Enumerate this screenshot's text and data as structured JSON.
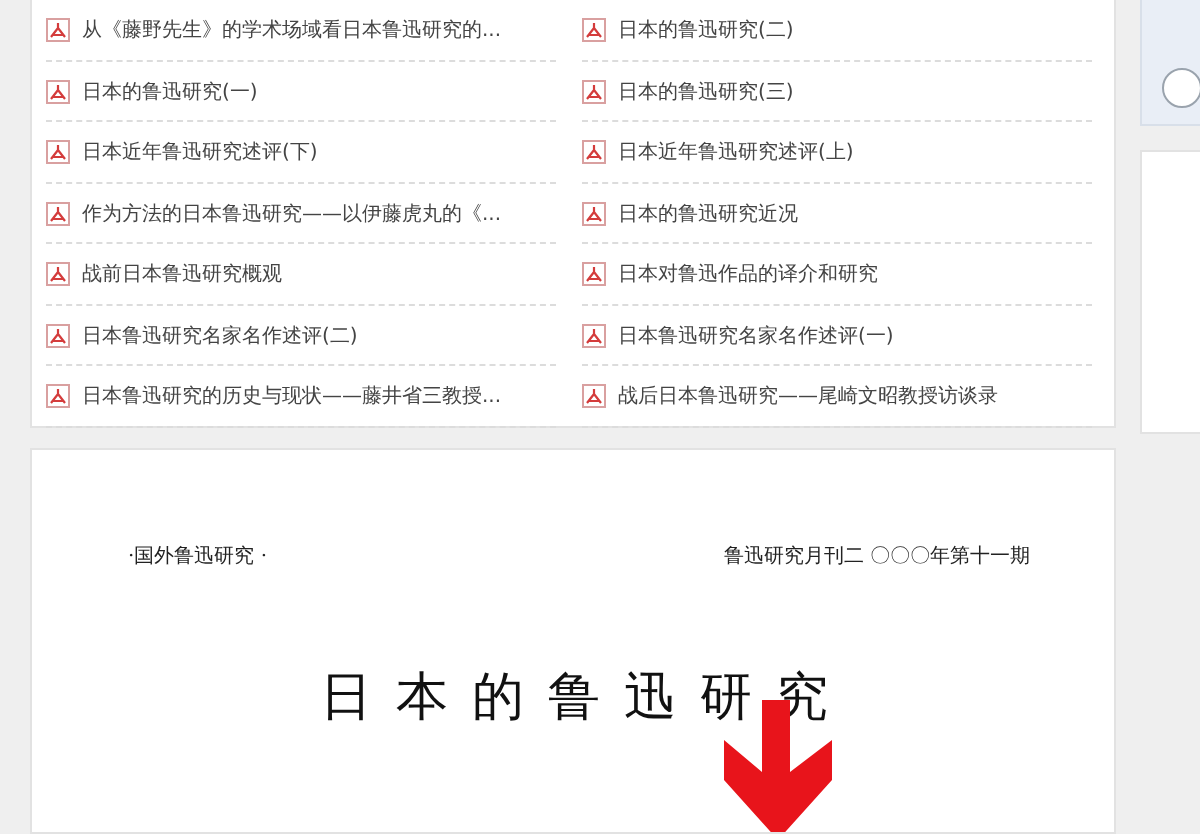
{
  "documents": [
    {
      "title": "从《藤野先生》的学术场域看日本鲁迅研究的..."
    },
    {
      "title": "日本的鲁迅研究(二)"
    },
    {
      "title": "日本的鲁迅研究(一)"
    },
    {
      "title": "日本的鲁迅研究(三)"
    },
    {
      "title": "日本近年鲁迅研究述评(下)"
    },
    {
      "title": "日本近年鲁迅研究述评(上)"
    },
    {
      "title": "作为方法的日本鲁迅研究——以伊藤虎丸的《..."
    },
    {
      "title": "日本的鲁迅研究近况"
    },
    {
      "title": "战前日本鲁迅研究概观"
    },
    {
      "title": "日本对鲁迅作品的译介和研究"
    },
    {
      "title": "日本鲁迅研究名家名作述评(二)"
    },
    {
      "title": "日本鲁迅研究名家名作述评(一)"
    },
    {
      "title": "日本鲁迅研究的历史与现状——藤井省三教授..."
    },
    {
      "title": "战后日本鲁迅研究——尾崎文昭教授访谈录"
    }
  ],
  "preview": {
    "header_left": "·国外鲁迅研究 ·",
    "header_right": "鲁迅研究月刊二 〇〇〇年第十一期",
    "title": "日本的鲁迅研究"
  }
}
